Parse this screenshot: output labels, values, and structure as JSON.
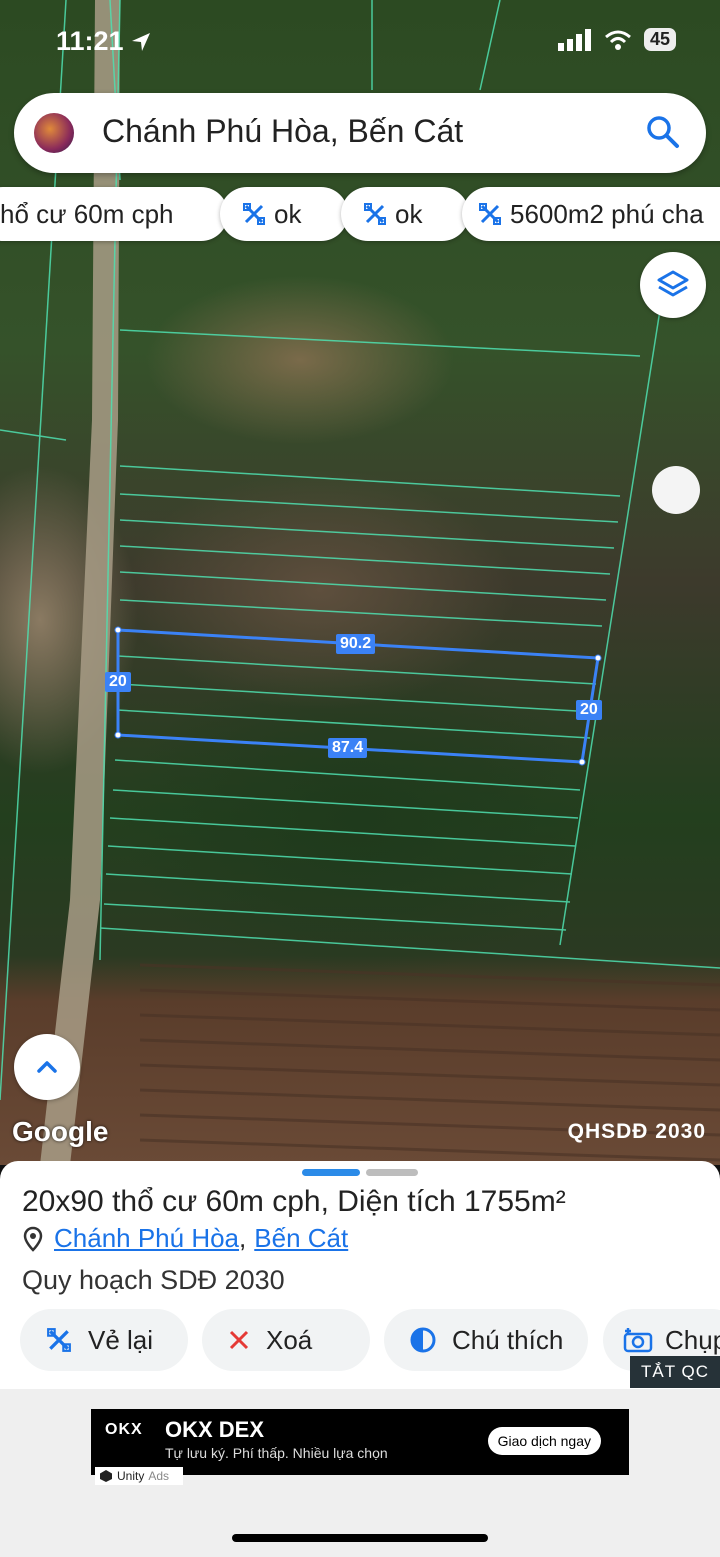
{
  "status_bar": {
    "time": "11:21",
    "battery": "45"
  },
  "search": {
    "query": "Chánh Phú Hòa, Bến Cát"
  },
  "chips": [
    {
      "label": "hổ cư 60m cph",
      "icon": "parcel-icon"
    },
    {
      "label": "ok",
      "icon": "parcel-icon"
    },
    {
      "label": "ok",
      "icon": "parcel-icon"
    },
    {
      "label": "5600m2 phú cha",
      "icon": "parcel-icon"
    }
  ],
  "map": {
    "google_label": "Google",
    "layer_label": "QHSDĐ 2030",
    "measurements": {
      "top": "90.2",
      "bottom": "87.4",
      "left": "20",
      "right": "20"
    }
  },
  "sheet": {
    "title": "20x90 thổ cư 60m cph, Diện tích 1755m²",
    "location_part1": "Chánh Phú Hòa",
    "separator": ",",
    "location_part2": "Bến Cát",
    "plan": "Quy hoạch SDĐ 2030",
    "actions": [
      {
        "label": "Vẻ lại",
        "icon": "redraw-icon"
      },
      {
        "label": "Xoá",
        "icon": "close-icon"
      },
      {
        "label": "Chú thích",
        "icon": "contrast-icon"
      },
      {
        "label": "Chụp",
        "icon": "camera-icon"
      }
    ]
  },
  "ad": {
    "hide_label": "TẮT QC",
    "logo": "OKX",
    "name": "OKX DEX",
    "subtitle": "Tự lưu ký. Phí thấp. Nhiều lựa chọn",
    "cta": "Giao dịch ngay",
    "network": "Unity",
    "network_suffix": "Ads"
  },
  "colors": {
    "accent": "#1a73e8",
    "parcel_line": "#3b82f6",
    "grid_line": "#4fe0b0"
  }
}
